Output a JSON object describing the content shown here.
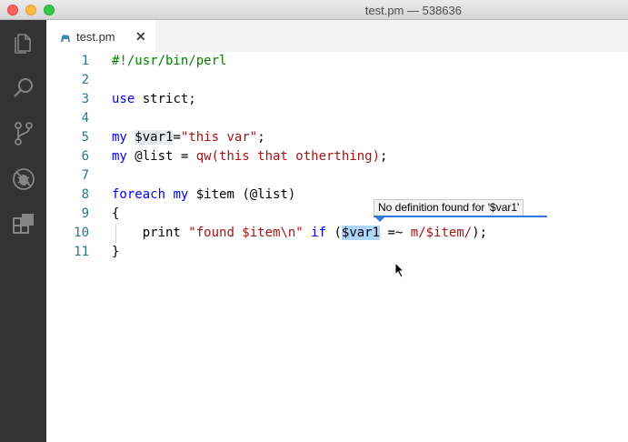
{
  "window": {
    "title": "test.pm — 538636"
  },
  "activity_bar": {
    "icons": [
      "explorer-icon",
      "search-icon",
      "source-control-icon",
      "debug-icon",
      "extensions-icon"
    ]
  },
  "tab": {
    "label": "test.pm",
    "close": "✕",
    "icon": "perl-camel-icon"
  },
  "editor": {
    "line_numbers": [
      "1",
      "2",
      "3",
      "4",
      "5",
      "6",
      "7",
      "8",
      "9",
      "10",
      "11"
    ],
    "lines": [
      "#!/usr/bin/perl",
      "",
      "use strict;",
      "",
      "my $var1=\"this var\";",
      "my @list = qw(this that otherthing);",
      "",
      "foreach my $item (@list)",
      "{",
      "    print \"found $item\\n\" if ($var1 =~ m/$item/);",
      "}"
    ],
    "tokens": {
      "shebang": "#!/usr/bin/perl",
      "use": "use",
      "strict": " strict;",
      "my": "my",
      "space": " ",
      "var1": "$var1",
      "assign": "=",
      "str_this_var": "\"this var\"",
      "semicolon": ";",
      "list_decl": " @list = ",
      "qw": "qw(this that otherthing)",
      "foreach": "foreach",
      "item_decl": " $item (@list)",
      "open_brace": "{",
      "indent": "    print ",
      "str_found": "\"found $item\\n\"",
      "if": "if",
      "paren_open": " (",
      "match": " =~ ",
      "regex": "m/$item/",
      "tail": ");",
      "close_brace": "}"
    }
  },
  "hover": {
    "text": "No definition found for '$var1'"
  },
  "colors": {
    "line_number": "#237893",
    "keyword": "#0000ff",
    "comment": "#008000",
    "string": "#a31515",
    "activity_bar": "#333333",
    "highlight": "#add6ff"
  }
}
